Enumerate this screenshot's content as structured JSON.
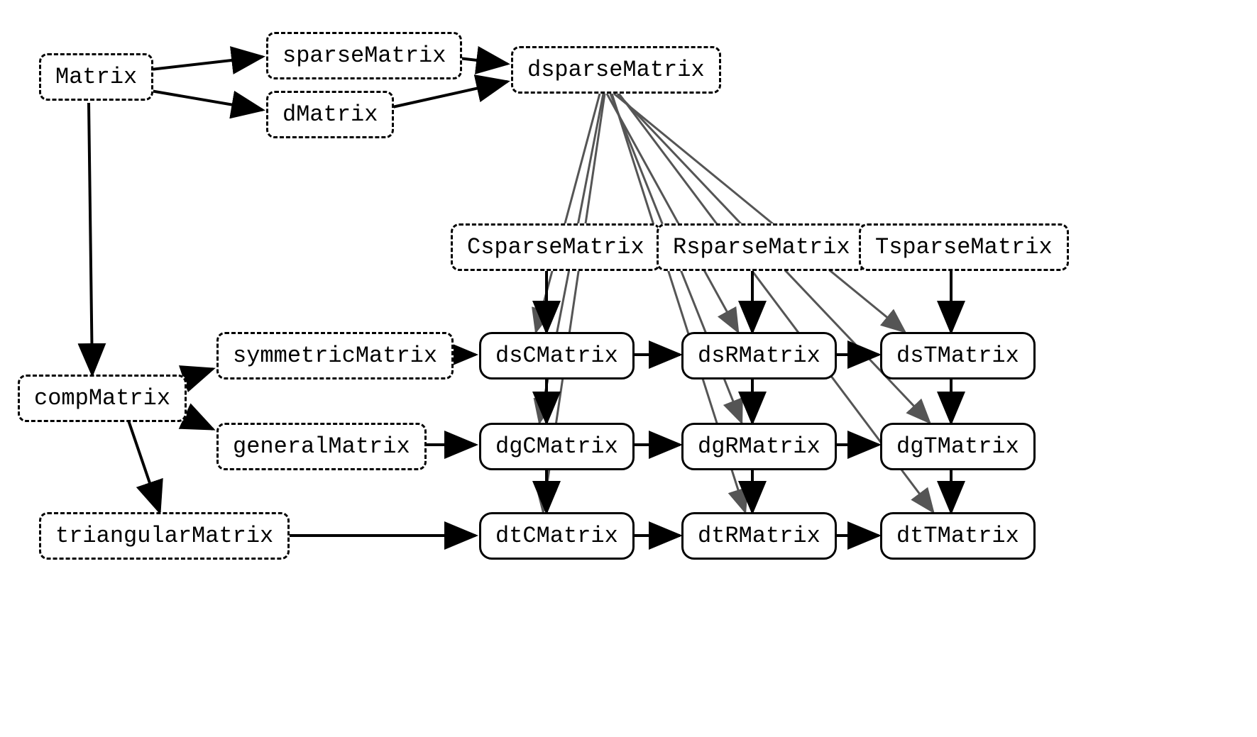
{
  "nodes": {
    "matrix": "Matrix",
    "sparseMatrix": "sparseMatrix",
    "dMatrix": "dMatrix",
    "dsparseMatrix": "dsparseMatrix",
    "compMatrix": "compMatrix",
    "CsparseMatrix": "CsparseMatrix",
    "RsparseMatrix": "RsparseMatrix",
    "TsparseMatrix": "TsparseMatrix",
    "symmetricMatrix": "symmetricMatrix",
    "generalMatrix": "generalMatrix",
    "triangularMatrix": "triangularMatrix",
    "dsCMatrix": "dsCMatrix",
    "dsRMatrix": "dsRMatrix",
    "dsTMatrix": "dsTMatrix",
    "dgCMatrix": "dgCMatrix",
    "dgRMatrix": "dgRMatrix",
    "dgTMatrix": "dgTMatrix",
    "dtCMatrix": "dtCMatrix",
    "dtRMatrix": "dtRMatrix",
    "dtTMatrix": "dtTMatrix"
  },
  "edges": [
    {
      "from": "matrix",
      "to": "sparseMatrix"
    },
    {
      "from": "matrix",
      "to": "dMatrix"
    },
    {
      "from": "matrix",
      "to": "compMatrix"
    },
    {
      "from": "sparseMatrix",
      "to": "dsparseMatrix"
    },
    {
      "from": "dMatrix",
      "to": "dsparseMatrix"
    },
    {
      "from": "compMatrix",
      "to": "symmetricMatrix"
    },
    {
      "from": "compMatrix",
      "to": "generalMatrix"
    },
    {
      "from": "compMatrix",
      "to": "triangularMatrix"
    },
    {
      "from": "symmetricMatrix",
      "to": "dsCMatrix"
    },
    {
      "from": "generalMatrix",
      "to": "dgCMatrix"
    },
    {
      "from": "triangularMatrix",
      "to": "dtCMatrix"
    },
    {
      "from": "CsparseMatrix",
      "to": "dsCMatrix"
    },
    {
      "from": "CsparseMatrix",
      "to": "dgCMatrix"
    },
    {
      "from": "CsparseMatrix",
      "to": "dtCMatrix"
    },
    {
      "from": "RsparseMatrix",
      "to": "dsRMatrix"
    },
    {
      "from": "RsparseMatrix",
      "to": "dgRMatrix"
    },
    {
      "from": "RsparseMatrix",
      "to": "dtRMatrix"
    },
    {
      "from": "TsparseMatrix",
      "to": "dsTMatrix"
    },
    {
      "from": "TsparseMatrix",
      "to": "dgTMatrix"
    },
    {
      "from": "TsparseMatrix",
      "to": "dtTMatrix"
    },
    {
      "from": "dsparseMatrix",
      "to": "dsCMatrix"
    },
    {
      "from": "dsparseMatrix",
      "to": "dsRMatrix"
    },
    {
      "from": "dsparseMatrix",
      "to": "dsTMatrix"
    },
    {
      "from": "dsparseMatrix",
      "to": "dgCMatrix"
    },
    {
      "from": "dsparseMatrix",
      "to": "dgRMatrix"
    },
    {
      "from": "dsparseMatrix",
      "to": "dgTMatrix"
    },
    {
      "from": "dsparseMatrix",
      "to": "dtCMatrix"
    },
    {
      "from": "dsparseMatrix",
      "to": "dtRMatrix"
    },
    {
      "from": "dsparseMatrix",
      "to": "dtTMatrix"
    },
    {
      "from": "dsCMatrix",
      "to": "dsRMatrix"
    },
    {
      "from": "dsRMatrix",
      "to": "dsTMatrix"
    },
    {
      "from": "dsCMatrix",
      "to": "dgCMatrix"
    },
    {
      "from": "dsRMatrix",
      "to": "dgRMatrix"
    },
    {
      "from": "dsTMatrix",
      "to": "dgTMatrix"
    },
    {
      "from": "dgCMatrix",
      "to": "dgRMatrix"
    },
    {
      "from": "dgRMatrix",
      "to": "dgTMatrix"
    },
    {
      "from": "dgCMatrix",
      "to": "dtCMatrix"
    },
    {
      "from": "dgRMatrix",
      "to": "dtRMatrix"
    },
    {
      "from": "dgTMatrix",
      "to": "dtTMatrix"
    },
    {
      "from": "dtCMatrix",
      "to": "dtRMatrix"
    },
    {
      "from": "dtRMatrix",
      "to": "dtTMatrix"
    }
  ]
}
